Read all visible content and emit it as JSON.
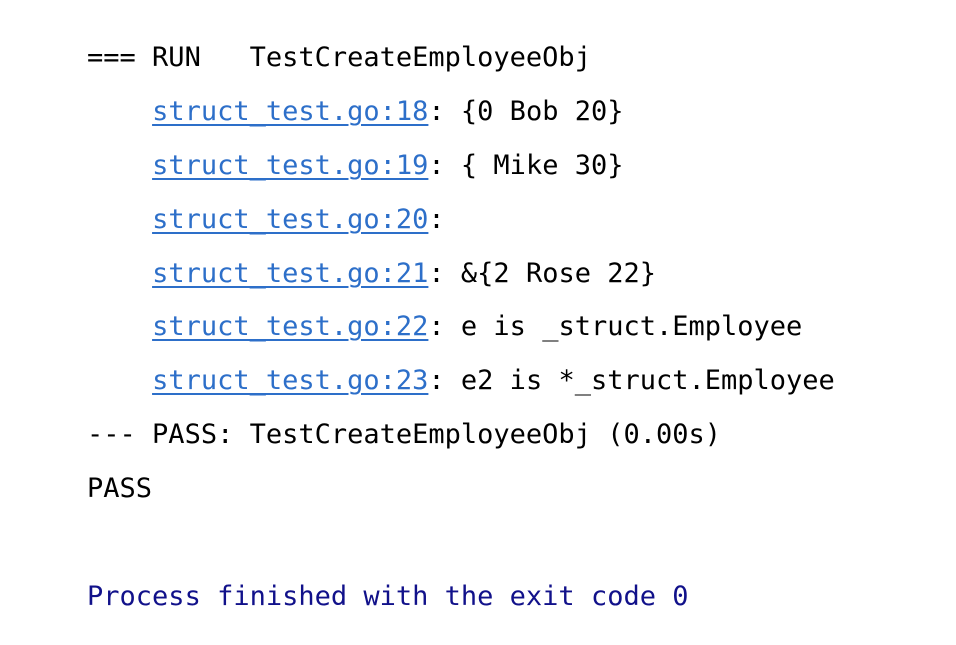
{
  "console": {
    "background_color": "#ffffff",
    "text_color": "#000000",
    "link_color": "#2D6FC9",
    "exit_color": "#11118A",
    "lines": [
      {
        "id": "run-header",
        "indent": "",
        "prefix": "=== RUN   TestCreateEmployeeObj",
        "link": "",
        "suffix": ""
      },
      {
        "id": "log-line-18",
        "indent": "    ",
        "prefix": "",
        "link": "struct_test.go:18",
        "suffix": ": {0 Bob 20}"
      },
      {
        "id": "log-line-19",
        "indent": "    ",
        "prefix": "",
        "link": "struct_test.go:19",
        "suffix": ": { Mike 30}"
      },
      {
        "id": "log-line-20",
        "indent": "    ",
        "prefix": "",
        "link": "struct_test.go:20",
        "suffix": ": "
      },
      {
        "id": "log-line-21",
        "indent": "    ",
        "prefix": "",
        "link": "struct_test.go:21",
        "suffix": ": &{2 Rose 22}"
      },
      {
        "id": "log-line-22",
        "indent": "    ",
        "prefix": "",
        "link": "struct_test.go:22",
        "suffix": ": e is _struct.Employee"
      },
      {
        "id": "log-line-23",
        "indent": "    ",
        "prefix": "",
        "link": "struct_test.go:23",
        "suffix": ": e2 is *_struct.Employee"
      },
      {
        "id": "test-result",
        "indent": "",
        "prefix": "--- PASS: TestCreateEmployeeObj (0.00s)",
        "link": "",
        "suffix": ""
      },
      {
        "id": "overall-result",
        "indent": "",
        "prefix": "PASS",
        "link": "",
        "suffix": ""
      },
      {
        "id": "blank-line",
        "indent": "",
        "prefix": "",
        "link": "",
        "suffix": ""
      }
    ],
    "exit_line": "Process finished with the exit code 0"
  }
}
